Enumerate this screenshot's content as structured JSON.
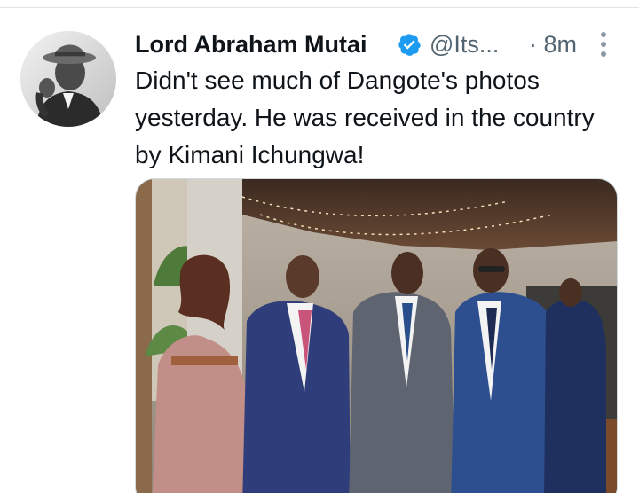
{
  "tweet": {
    "author": {
      "display_name": "Lord Abraham Mutai",
      "handle": "@Its...",
      "verified": true
    },
    "time_ago": "· 8m",
    "text": "Didn't see much of Dangote's photos yesterday. He was received in the country by Kimani Ichungwa!",
    "media": {
      "kind": "photo",
      "count": 1
    }
  },
  "icons": {
    "verified": "verified-badge-icon",
    "more": "more-vertical-icon"
  },
  "colors": {
    "verified_blue": "#1d9bf0",
    "secondary_text": "#536471",
    "primary_text": "#0f1419",
    "divider": "#dde3e7"
  }
}
